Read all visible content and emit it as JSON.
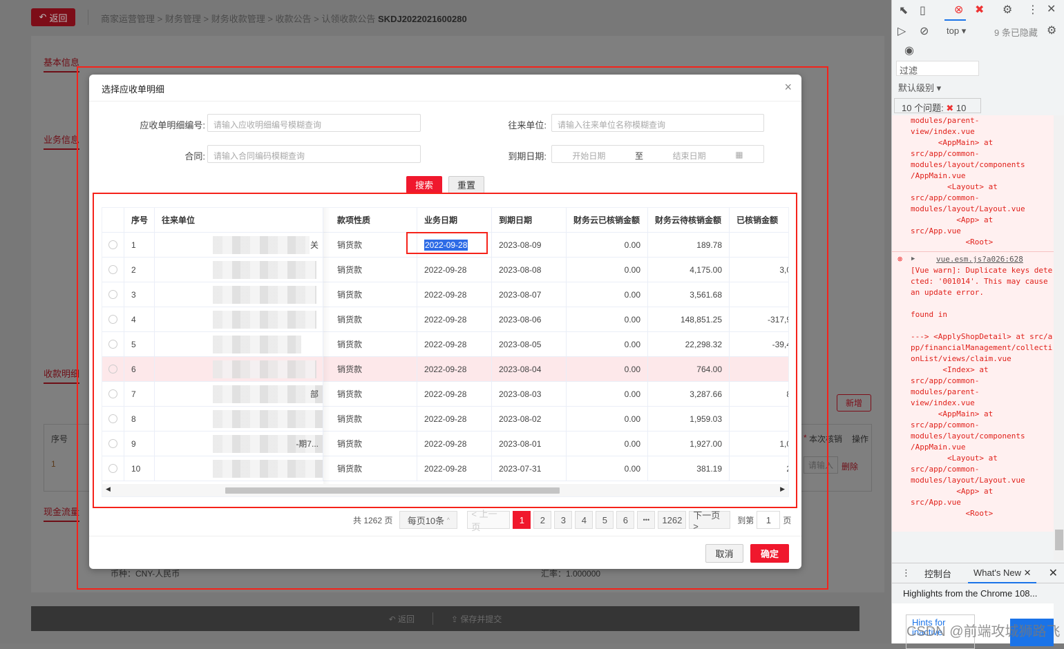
{
  "header": {
    "back_label": "返回",
    "breadcrumb": [
      "商家运营管理",
      "财务管理",
      "财务收款管理",
      "收款公告",
      "认领收款公告"
    ],
    "doc_no": "SKDJ2022021600280"
  },
  "background": {
    "sections": [
      "基本信息",
      "业务信息",
      "收款明细",
      "现金流量"
    ],
    "table_headers": {
      "index": "序号",
      "required_mark": "*",
      "writeoff": "本次核销",
      "operation": "操作"
    },
    "row_index": "1",
    "row_input_placeholder": "请输入",
    "delete_label": "删除",
    "add_label": "新增",
    "currency": "币种：CNY-人民币",
    "exchange_rate": "汇率：1.000000",
    "footer_back": "返回",
    "footer_submit": "保存并提交"
  },
  "dialog": {
    "title": "选择应收单明细",
    "filters": {
      "detail_no_label": "应收单明细编号:",
      "detail_no_placeholder": "请输入应收明细编号模糊查询",
      "unit_label": "往来单位:",
      "unit_placeholder": "请输入往来单位名称模糊查询",
      "contract_label": "合同:",
      "contract_placeholder": "请输入合同编码模糊查询",
      "due_label": "到期日期:",
      "start_placeholder": "开始日期",
      "range_sep": "至",
      "end_placeholder": "结束日期"
    },
    "search_label": "搜索",
    "reset_label": "重置",
    "columns": [
      "序号",
      "往来单位",
      "款项性质",
      "业务日期",
      "到期日期",
      "财务云已核销金额",
      "财务云待核销金额",
      "已核销金额"
    ],
    "rows": [
      {
        "no": "1",
        "unit_suffix": "关",
        "type": "销货款",
        "biz_date": "2022-09-28",
        "due_date": "2023-08-09",
        "fin_done": "0.00",
        "fin_pending": "189.78",
        "done": "-"
      },
      {
        "no": "2",
        "unit_suffix": "",
        "type": "销货款",
        "biz_date": "2022-09-28",
        "due_date": "2023-08-08",
        "fin_done": "0.00",
        "fin_pending": "4,175.00",
        "done": "3,0"
      },
      {
        "no": "3",
        "unit_suffix": "",
        "type": "销货款",
        "biz_date": "2022-09-28",
        "due_date": "2023-08-07",
        "fin_done": "0.00",
        "fin_pending": "3,561.68",
        "done": ""
      },
      {
        "no": "4",
        "unit_suffix": "",
        "type": "销货款",
        "biz_date": "2022-09-28",
        "due_date": "2023-08-06",
        "fin_done": "0.00",
        "fin_pending": "148,851.25",
        "done": "-317,9"
      },
      {
        "no": "5",
        "unit_suffix": "",
        "type": "销货款",
        "biz_date": "2022-09-28",
        "due_date": "2023-08-05",
        "fin_done": "0.00",
        "fin_pending": "22,298.32",
        "done": "-39,4"
      },
      {
        "no": "6",
        "unit_suffix": "",
        "type": "销货款",
        "biz_date": "2022-09-28",
        "due_date": "2023-08-04",
        "fin_done": "0.00",
        "fin_pending": "764.00",
        "done": ""
      },
      {
        "no": "7",
        "unit_suffix": "部",
        "type": "销货款",
        "biz_date": "2022-09-28",
        "due_date": "2023-08-03",
        "fin_done": "0.00",
        "fin_pending": "3,287.66",
        "done": "8"
      },
      {
        "no": "8",
        "unit_suffix": "",
        "type": "销货款",
        "biz_date": "2022-09-28",
        "due_date": "2023-08-02",
        "fin_done": "0.00",
        "fin_pending": "1,959.03",
        "done": ""
      },
      {
        "no": "9",
        "unit_suffix": "-期7...",
        "type": "销货款",
        "biz_date": "2022-09-28",
        "due_date": "2023-08-01",
        "fin_done": "0.00",
        "fin_pending": "1,927.00",
        "done": "1,0"
      },
      {
        "no": "10",
        "unit_suffix": "",
        "type": "销货款",
        "biz_date": "2022-09-28",
        "due_date": "2023-07-31",
        "fin_done": "0.00",
        "fin_pending": "381.19",
        "done": "2"
      }
    ],
    "pagination": {
      "total": "共 1262 页",
      "page_size": "每页10条",
      "prev": "< 上一页",
      "pages": [
        "1",
        "2",
        "3",
        "4",
        "5",
        "6"
      ],
      "ellipsis": "•••",
      "last": "1262",
      "next": "下一页 >",
      "goto_label": "到第",
      "goto_value": "1",
      "goto_suffix": "页",
      "current": 1
    },
    "cancel_label": "取消",
    "ok_label": "确定"
  },
  "devtools": {
    "context": "top",
    "hidden": "9 条已隐藏",
    "filter_placeholder": "过滤",
    "level": "默认级别",
    "issues": "10 个问题:",
    "issues_count": "10",
    "log_pre": "modules/parent-\nview/index.vue\n      <AppMain> at\nsrc/app/common-\nmodules/layout/components\n/AppMain.vue\n        <Layout> at\nsrc/app/common-\nmodules/layout/Layout.vue\n          <App> at\nsrc/App.vue\n            <Root>",
    "error_source": "vue.esm.js?a026:628",
    "error_msg": "[Vue warn]: Duplicate keys detected: '001014'. This may cause an update error.\n\nfound in\n\n---> <ApplyShopDetail> at src/app/financialManagement/collectionList/views/claim.vue\n       <Index> at\nsrc/app/common-\nmodules/parent-\nview/index.vue\n      <AppMain> at\nsrc/app/common-\nmodules/layout/components\n/AppMain.vue\n        <Layout> at\nsrc/app/common-\nmodules/layout/Layout.vue\n          <App> at\nsrc/App.vue\n            <Root>",
    "tab_console": "控制台",
    "tab_whatsnew": "What's New",
    "whatsnew_headline": "Highlights from the Chrome 108...",
    "hints": "Hints for inactive"
  },
  "watermark": "CSDN @前端攻城狮路飞",
  "colors": {
    "accent": "#f0182d",
    "annotation": "#f5221a"
  }
}
